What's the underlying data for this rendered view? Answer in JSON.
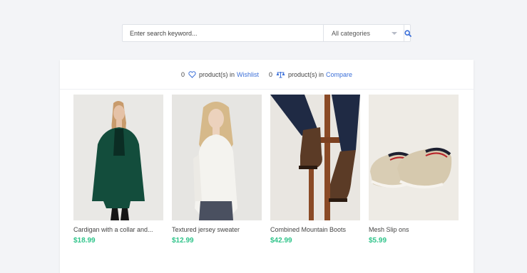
{
  "search": {
    "placeholder": "Enter search keyword...",
    "category": "All categories"
  },
  "stats": {
    "wishlist_count": "0",
    "compare_count": "0",
    "products_in": "product(s) in",
    "wishlist_label": "Wishlist",
    "compare_label": "Compare"
  },
  "products": [
    {
      "name": "Cardigan with a collar and...",
      "price": "$18.99",
      "image": "woman in green cardigan"
    },
    {
      "name": "Textured jersey sweater",
      "price": "$12.99",
      "image": "woman in white sweater"
    },
    {
      "name": "Combined Mountain Boots",
      "price": "$42.99",
      "image": "brown mountain boots"
    },
    {
      "name": "Mesh Slip ons",
      "price": "$5.99",
      "image": "beige slip on shoes"
    }
  ],
  "colors": {
    "accent": "#3b6fd8",
    "price": "#2fc48a"
  }
}
